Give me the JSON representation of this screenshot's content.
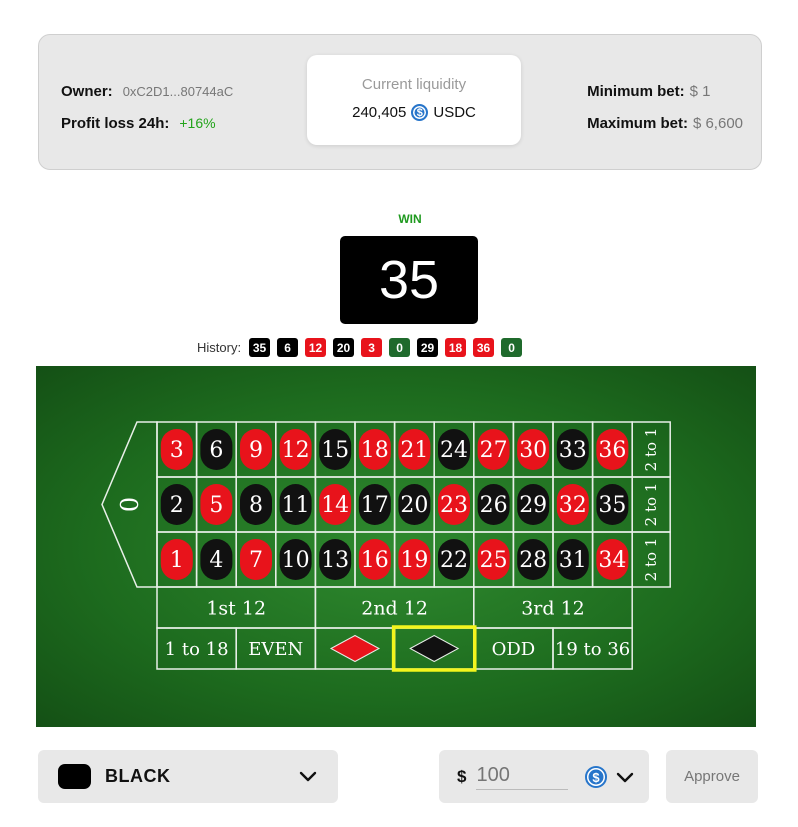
{
  "info": {
    "owner_label": "Owner:",
    "owner_value": "0xC2D1...80744aC",
    "profit_label": "Profit loss 24h:",
    "profit_value": "+16%",
    "liquidity_title": "Current liquidity",
    "liquidity_value": "240,405",
    "liquidity_currency": "USDC",
    "min_bet_label": "Minimum bet:",
    "min_bet_value": "$ 1",
    "max_bet_label": "Maximum bet:",
    "max_bet_value": "$ 6,600"
  },
  "result": {
    "status": "WIN",
    "number": "35"
  },
  "history": {
    "label": "History:",
    "items": [
      {
        "n": "35",
        "color": "black"
      },
      {
        "n": "6",
        "color": "black"
      },
      {
        "n": "12",
        "color": "red"
      },
      {
        "n": "20",
        "color": "black"
      },
      {
        "n": "3",
        "color": "red"
      },
      {
        "n": "0",
        "color": "green"
      },
      {
        "n": "29",
        "color": "black"
      },
      {
        "n": "18",
        "color": "red"
      },
      {
        "n": "36",
        "color": "red"
      },
      {
        "n": "0",
        "color": "green"
      }
    ]
  },
  "table": {
    "zero": "0",
    "rows": [
      [
        {
          "n": "3",
          "c": "red"
        },
        {
          "n": "6",
          "c": "black"
        },
        {
          "n": "9",
          "c": "red"
        },
        {
          "n": "12",
          "c": "red"
        },
        {
          "n": "15",
          "c": "black"
        },
        {
          "n": "18",
          "c": "red"
        },
        {
          "n": "21",
          "c": "red"
        },
        {
          "n": "24",
          "c": "black"
        },
        {
          "n": "27",
          "c": "red"
        },
        {
          "n": "30",
          "c": "red"
        },
        {
          "n": "33",
          "c": "black"
        },
        {
          "n": "36",
          "c": "red"
        }
      ],
      [
        {
          "n": "2",
          "c": "black"
        },
        {
          "n": "5",
          "c": "red"
        },
        {
          "n": "8",
          "c": "black"
        },
        {
          "n": "11",
          "c": "black"
        },
        {
          "n": "14",
          "c": "red"
        },
        {
          "n": "17",
          "c": "black"
        },
        {
          "n": "20",
          "c": "black"
        },
        {
          "n": "23",
          "c": "red"
        },
        {
          "n": "26",
          "c": "black"
        },
        {
          "n": "29",
          "c": "black"
        },
        {
          "n": "32",
          "c": "red"
        },
        {
          "n": "35",
          "c": "black"
        }
      ],
      [
        {
          "n": "1",
          "c": "red"
        },
        {
          "n": "4",
          "c": "black"
        },
        {
          "n": "7",
          "c": "red"
        },
        {
          "n": "10",
          "c": "black"
        },
        {
          "n": "13",
          "c": "black"
        },
        {
          "n": "16",
          "c": "red"
        },
        {
          "n": "19",
          "c": "red"
        },
        {
          "n": "22",
          "c": "black"
        },
        {
          "n": "25",
          "c": "red"
        },
        {
          "n": "28",
          "c": "black"
        },
        {
          "n": "31",
          "c": "black"
        },
        {
          "n": "34",
          "c": "red"
        }
      ]
    ],
    "column_bets": [
      "2 to 1",
      "2 to 1",
      "2 to 1"
    ],
    "dozens": [
      "1st 12",
      "2nd 12",
      "3rd 12"
    ],
    "outside": [
      "1 to 18",
      "EVEN",
      "",
      "",
      "ODD",
      "19 to 36"
    ],
    "selected_outside": "black"
  },
  "controls": {
    "color_label": "BLACK",
    "currency_symbol": "$",
    "amount_placeholder": "100",
    "approve_label": "Approve"
  },
  "colors": {
    "red": "#e8131b",
    "black": "#111111",
    "green": "#1f6a2c",
    "felt": "#1d6b1e",
    "win": "#1f9a1f",
    "profit": "#22a31a",
    "highlight": "#f3f51c",
    "usdc": "#2775ca"
  }
}
